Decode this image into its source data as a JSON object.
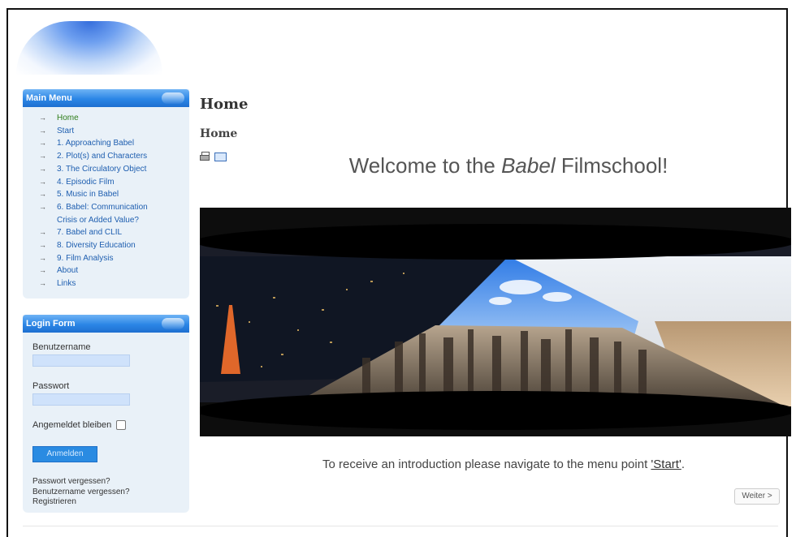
{
  "colors": {
    "menu_link": "#1f5fb0",
    "active_link": "#2e7d1a",
    "panel_bg": "#e9f1f8",
    "header_blue": "#2b86e6"
  },
  "sidebar": {
    "main_menu": {
      "title": "Main Menu",
      "items": [
        {
          "label": "Home",
          "active": true
        },
        {
          "label": "Start"
        },
        {
          "label": "1. Approaching Babel"
        },
        {
          "label": "2. Plot(s) and Characters"
        },
        {
          "label": "3. The Circulatory Object"
        },
        {
          "label": "4. Episodic Film"
        },
        {
          "label": "5. Music in Babel"
        },
        {
          "label": "6. Babel: Communication",
          "continuation": "Crisis or Added Value?"
        },
        {
          "label": "7. Babel and CLIL"
        },
        {
          "label": "8. Diversity Education"
        },
        {
          "label": "9. Film Analysis"
        },
        {
          "label": "About"
        },
        {
          "label": "Links"
        }
      ]
    },
    "login": {
      "title": "Login Form",
      "username_label": "Benutzername",
      "username_value": "",
      "password_label": "Passwort",
      "password_value": "",
      "remember_label": "Angemeldet bleiben",
      "remember_checked": false,
      "submit_label": "Anmelden",
      "forgot_password": "Passwort vergessen?",
      "forgot_username": "Benutzername vergessen?",
      "register": "Registrieren"
    }
  },
  "main": {
    "page_title": "Home",
    "article_title": "Home",
    "icons": [
      "print-icon",
      "email-icon"
    ],
    "welcome_prefix": "Welcome to the ",
    "welcome_italic": "Babel",
    "welcome_suffix": " Filmschool!",
    "intro_text": "To receive an introduction please navigate to the menu point ",
    "intro_link": "'Start'",
    "intro_end": ".",
    "next_button": "Weiter >"
  }
}
